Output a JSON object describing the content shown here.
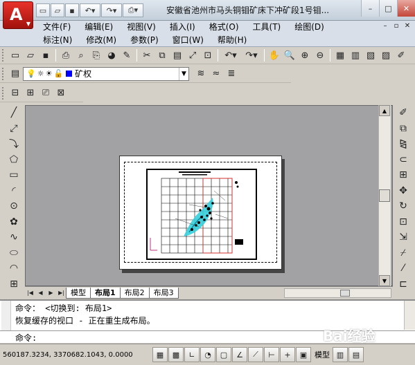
{
  "window": {
    "title": "安徽省池州市马头铜钼矿床下冲矿段1号钼...",
    "controls": [
      "–",
      "□",
      "✕"
    ]
  },
  "quick_access": {
    "icons": [
      "new-file-icon",
      "open-folder-icon",
      "save-icon",
      "undo-icon",
      "redo-icon",
      "print-icon"
    ]
  },
  "menu": {
    "row1": [
      "文件(F)",
      "编辑(E)",
      "视图(V)",
      "插入(I)",
      "格式(O)",
      "工具(T)",
      "绘图(D)"
    ],
    "row2": [
      "标注(N)",
      "修改(M)",
      "参数(P)",
      "窗口(W)",
      "帮助(H)"
    ],
    "mdi_controls": [
      "–",
      "▫",
      "✕"
    ]
  },
  "layer": {
    "name": "矿权",
    "color": "#0000ff"
  },
  "layout_tabs": {
    "tabs": [
      "模型",
      "布局1",
      "布局2",
      "布局3"
    ],
    "active": "布局1"
  },
  "command": {
    "line1": "命令：  <切换到: 布局1>",
    "line2": "恢复缓存的视口 - 正在重生成布局。",
    "prompt": "命令:"
  },
  "status": {
    "coordinates": "560187.3234, 3370682.1043, 0.0000",
    "mode_label": "模型",
    "watermark": "Bai经验"
  },
  "colors": {
    "accent": "#c4231b",
    "drawing_cyan": "#35d0dc",
    "boundary_red": "#d03030"
  }
}
